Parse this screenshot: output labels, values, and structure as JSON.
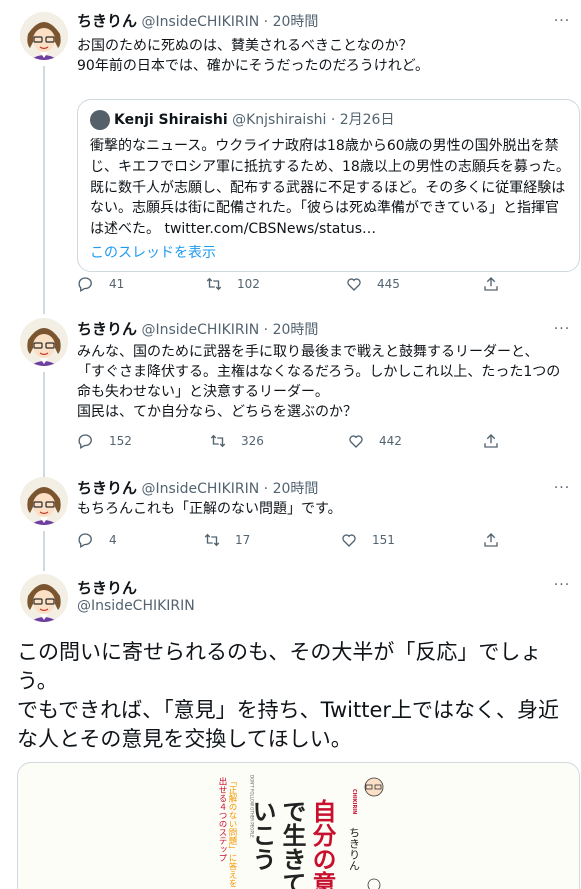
{
  "tweets": [
    {
      "name": "ちきりん",
      "handle": "@InsideCHIKIRIN",
      "sep": " · ",
      "time": "20時間",
      "text": "お国のために死ぬのは、賛美されるべきことなのか？\n90年前の日本では、確かにそうだったのだろうけれど。",
      "quote": {
        "name": "Kenji Shiraishi",
        "handle": "@Knjshiraishi",
        "sep": " · ",
        "time": "2月26日",
        "text": "衝撃的なニュース。ウクライナ政府は18歳から60歳の男性の国外脱出を禁じ、キエフでロシア軍に抵抗するため、18歳以上の男性の志願兵を募った。既に数千人が志願し、配布する武器に不足するほど。その多くに従軍経験はない。志願兵は街に配備された。「彼らは死ぬ準備ができている」と指揮官は述べた。 twitter.com/CBSNews/status…",
        "show_thread": "このスレッドを表示"
      },
      "replies": "41",
      "retweets": "102",
      "likes": "445"
    },
    {
      "name": "ちきりん",
      "handle": "@InsideCHIKIRIN",
      "sep": " · ",
      "time": "20時間",
      "text": "みんな、国のために武器を手に取り最後まで戦えと鼓舞するリーダーと、\n「すぐさま降伏する。主権はなくなるだろう。しかしこれ以上、たった1つの命も失わせない」と決意するリーダー。\n国民は、てか自分なら、どちらを選ぶのか？",
      "replies": "152",
      "retweets": "326",
      "likes": "442"
    },
    {
      "name": "ちきりん",
      "handle": "@InsideCHIKIRIN",
      "sep": " · ",
      "time": "20時間",
      "text": "もちろんこれも「正解のない問題」です。",
      "replies": "4",
      "retweets": "17",
      "likes": "151"
    }
  ],
  "main_tweet": {
    "name": "ちきりん",
    "handle": "@InsideCHIKIRIN",
    "text": "この問いに寄せられるのも、その大半が「反応」でしょう。\nでもできれば、「意見」を持ち、Twitter上ではなく、身近な人とその意見を交換してほしい。"
  },
  "book": {
    "title": "自分の意見で生きていこう",
    "subtitle": "「正解のない問題」に答えを出せる４つのステップ",
    "author": "ちきりん",
    "english": "DON'T FOLLOW OTHER PEOPLE, FOLLOW YOURSELF!"
  },
  "icons": {
    "reply": "reply-icon",
    "retweet": "retweet-icon",
    "like": "like-icon",
    "share": "share-icon",
    "more": "more-icon"
  },
  "colors": {
    "link": "#1d9bf0",
    "secondary": "#536471",
    "border": "#cfd9de",
    "book_red": "#c8102e",
    "book_orange": "#f39800"
  }
}
